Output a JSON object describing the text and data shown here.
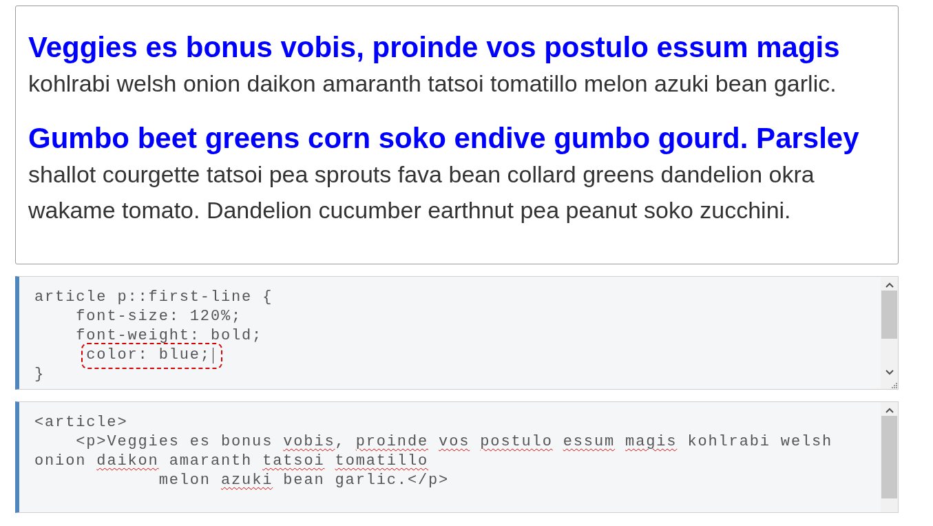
{
  "preview": {
    "paragraphs": [
      "Veggies es bonus vobis, proinde vos postulo essum magis kohlrabi welsh onion daikon amaranth tatsoi tomatillo melon azuki bean garlic.",
      "Gumbo beet greens corn soko endive gumbo gourd. Parsley shallot courgette tatsoi pea sprouts fava bean collard greens dandelion okra wakame tomato. Dandelion cucumber earthnut pea peanut soko zucchini."
    ]
  },
  "editors": [
    {
      "lines": [
        {
          "segments": [
            {
              "text": "article p::first-line {"
            }
          ],
          "highlighted": false,
          "cursor": false
        },
        {
          "segments": [
            {
              "text": "    font-size: 120%;"
            }
          ],
          "highlighted": false,
          "cursor": false
        },
        {
          "segments": [
            {
              "text": "    font-weight: bold;"
            }
          ],
          "highlighted": false,
          "cursor": false
        },
        {
          "segments": [
            {
              "text": "     color: blue;"
            }
          ],
          "highlighted": true,
          "cursor": true
        },
        {
          "segments": [
            {
              "text": "}"
            }
          ],
          "highlighted": false,
          "cursor": false
        }
      ]
    },
    {
      "lines": [
        {
          "segments": [
            {
              "text": "<article>"
            }
          ],
          "highlighted": false,
          "cursor": false
        },
        {
          "segments": [
            {
              "text": "    <p>Veggies es bonus "
            },
            {
              "text": "vobis",
              "misspelled": true
            },
            {
              "text": ", "
            },
            {
              "text": "proinde",
              "misspelled": true
            },
            {
              "text": " vos",
              "misspelled": true
            },
            {
              "text": " postulo",
              "misspelled": true
            },
            {
              "text": " essum",
              "misspelled": true
            },
            {
              "text": " magis",
              "misspelled": true
            },
            {
              "text": " kohlrabi welsh"
            }
          ],
          "highlighted": false,
          "cursor": false
        },
        {
          "segments": [
            {
              "text": "onion "
            },
            {
              "text": "daikon",
              "misspelled": true
            },
            {
              "text": " amaranth "
            },
            {
              "text": "tatsoi",
              "misspelled": true
            },
            {
              "text": " tomatillo",
              "misspelled": true
            }
          ],
          "highlighted": false,
          "cursor": false
        },
        {
          "segments": [
            {
              "text": "            melon "
            },
            {
              "text": "azuki",
              "misspelled": true
            },
            {
              "text": " bean garlic.</p>"
            }
          ],
          "highlighted": false,
          "cursor": false
        }
      ]
    }
  ]
}
